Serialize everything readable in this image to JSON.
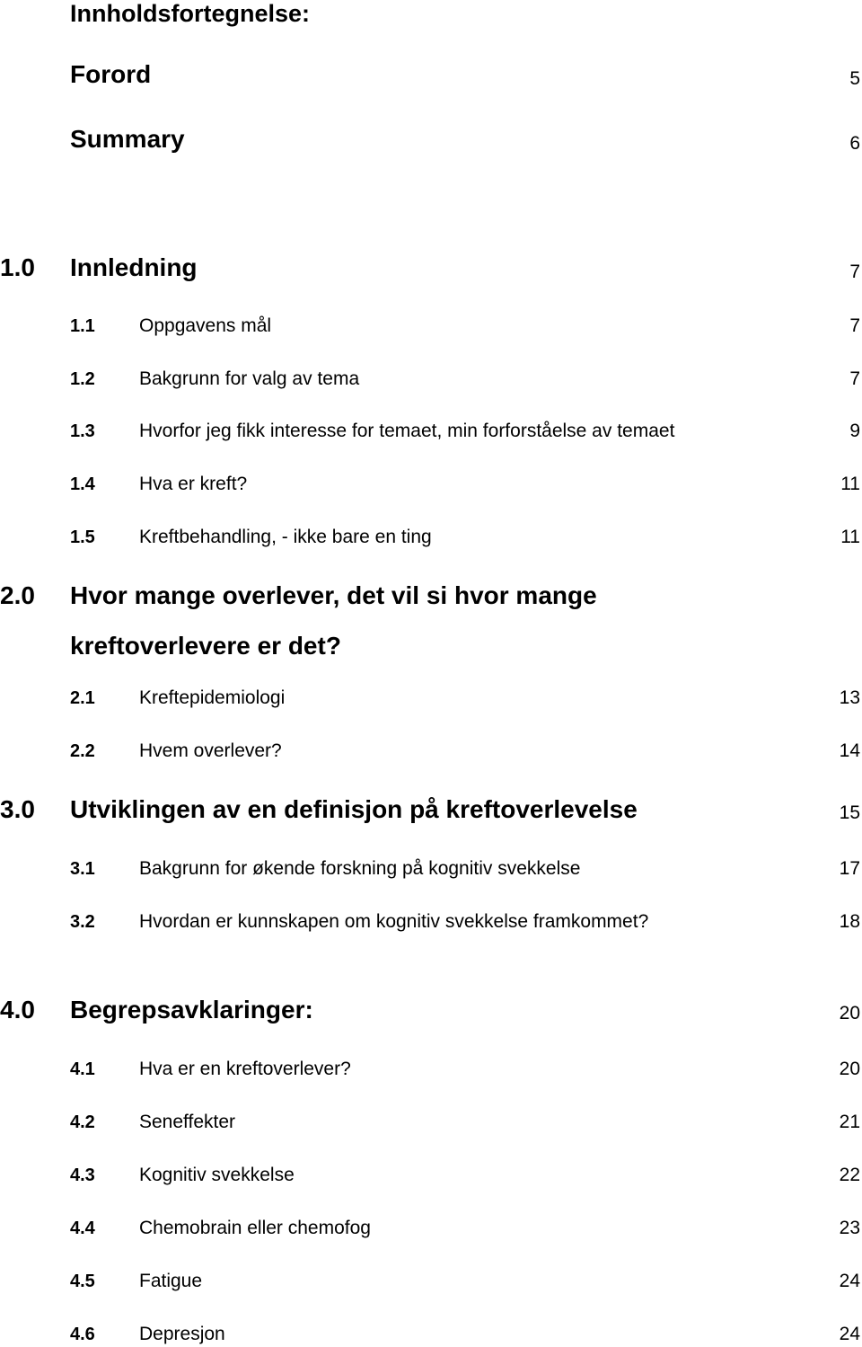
{
  "toc": {
    "title": "Innholdsfortegnelse:",
    "front_matter": [
      {
        "label": "Forord",
        "page": "5"
      },
      {
        "label": "Summary",
        "page": "6"
      }
    ],
    "chapters": [
      {
        "number": "1.0",
        "title": "Innledning",
        "page": "7",
        "sections": [
          {
            "number": "1.1",
            "title": "Oppgavens mål",
            "page": "7"
          },
          {
            "number": "1.2",
            "title": "Bakgrunn for valg av tema",
            "page": "7"
          },
          {
            "number": "1.3",
            "title": "Hvorfor jeg fikk interesse for temaet, min forforståelse av temaet",
            "page": "9"
          },
          {
            "number": "1.4",
            "title": "Hva er kreft?",
            "page": "11"
          },
          {
            "number": "1.5",
            "title": "Kreftbehandling, - ikke bare en ting",
            "page": "11"
          }
        ]
      },
      {
        "number": "2.0",
        "title_line1": "Hvor mange overlever, det vil si hvor mange",
        "title_line2": "kreftoverlevere er det?",
        "page": "",
        "sections": [
          {
            "number": "2.1",
            "title": "Kreftepidemiologi",
            "page": "13"
          },
          {
            "number": "2.2",
            "title": "Hvem overlever?",
            "page": "14"
          }
        ]
      },
      {
        "number": "3.0",
        "title": "Utviklingen av en definisjon på kreftoverlevelse",
        "page": "15",
        "sections": [
          {
            "number": "3.1",
            "title": "Bakgrunn for økende forskning på kognitiv svekkelse",
            "page": "17"
          },
          {
            "number": "3.2",
            "title": "Hvordan er kunnskapen om kognitiv svekkelse framkommet?",
            "page": "18"
          }
        ]
      },
      {
        "number": "4.0",
        "title": "Begrepsavklaringer:",
        "page": "20",
        "sections": [
          {
            "number": "4.1",
            "title": "Hva er en kreftoverlever?",
            "page": "20"
          },
          {
            "number": "4.2",
            "title": "Seneffekter",
            "page": "21"
          },
          {
            "number": "4.3",
            "title": "Kognitiv svekkelse",
            "page": "22"
          },
          {
            "number": "4.4",
            "title": "Chemobrain eller chemofog",
            "page": "23"
          },
          {
            "number": "4.5",
            "title": "Fatigue",
            "page": "24"
          },
          {
            "number": "4.6",
            "title": "Depresjon",
            "page": "24"
          }
        ]
      }
    ]
  }
}
